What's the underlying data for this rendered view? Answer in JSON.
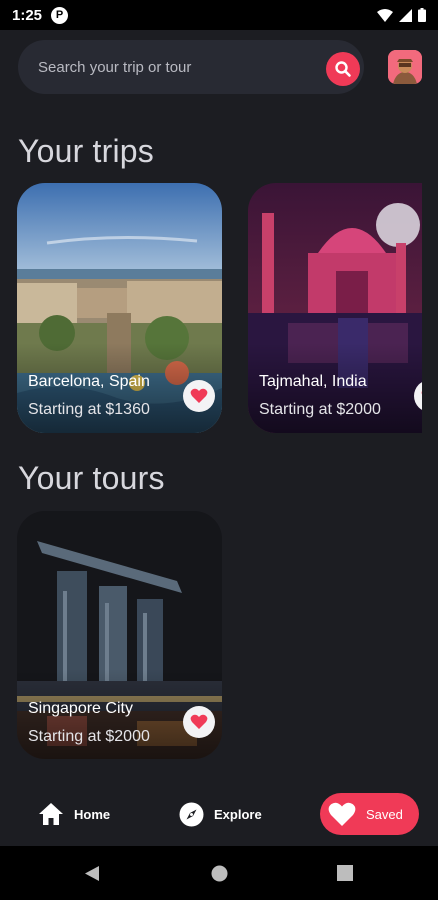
{
  "status_bar": {
    "time": "1:25",
    "notification_glyph": "P",
    "icons": [
      "wifi-icon",
      "signal-icon",
      "battery-icon"
    ]
  },
  "search": {
    "placeholder": "Search your trip or tour",
    "value": "",
    "accent": "#f03a57"
  },
  "sections": {
    "trips_title": "Your trips",
    "tours_title": "Your tours"
  },
  "trips": [
    {
      "title": "Barcelona, Spain",
      "price": "Starting at $1360",
      "favorite": true
    },
    {
      "title": "Tajmahal, India",
      "price": "Starting at $2000",
      "favorite": true
    }
  ],
  "tours": [
    {
      "title": "Singapore City",
      "price": "Starting at $2000",
      "favorite": true
    }
  ],
  "bottom_nav": {
    "items": [
      {
        "label": "Home",
        "icon": "home-icon",
        "active": false
      },
      {
        "label": "Explore",
        "icon": "compass-icon",
        "active": false
      },
      {
        "label": "Saved",
        "icon": "heart-icon",
        "active": true
      }
    ]
  },
  "colors": {
    "background": "#1c1d22",
    "surface": "#282a33",
    "accent": "#f03a57"
  }
}
